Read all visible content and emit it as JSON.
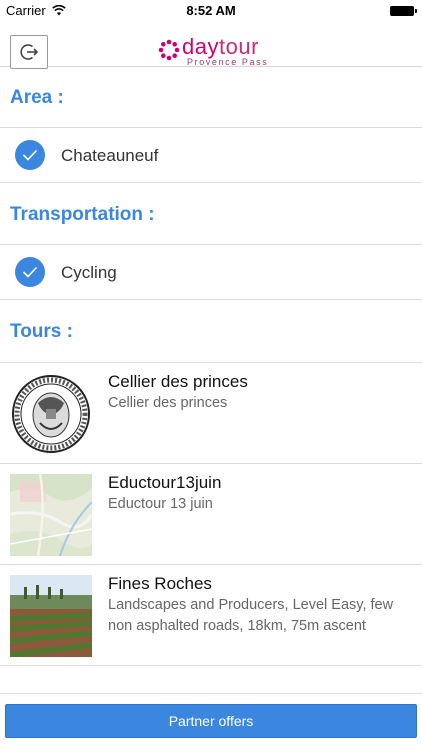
{
  "status_bar": {
    "carrier": "Carrier",
    "time": "8:52 AM",
    "icons": [
      "wifi-icon",
      "battery-icon"
    ]
  },
  "nav": {
    "logo_day": "day",
    "logo_tour": "tour",
    "logo_sub": "Provence Pass",
    "logout_icon": "logout-icon"
  },
  "area": {
    "title": "Area :",
    "selected": "Chateauneuf"
  },
  "transportation": {
    "title": "Transportation :",
    "selected": "Cycling"
  },
  "tours": {
    "title": "Tours :",
    "items": [
      {
        "title": "Cellier des princes",
        "desc": "Cellier des princes",
        "thumb": "seal-image"
      },
      {
        "title": "Eductour13juin",
        "desc": "Eductour 13 juin",
        "thumb": "map-image"
      },
      {
        "title": "Fines Roches",
        "desc": "Landscapes and Producers, Level Easy, few non asphalted roads, 18km, 75m ascent",
        "thumb": "vineyard-image"
      }
    ]
  },
  "footer": {
    "partner_label": "Partner offers"
  },
  "colors": {
    "accent": "#3b87e0",
    "brand": "#d1006f"
  }
}
